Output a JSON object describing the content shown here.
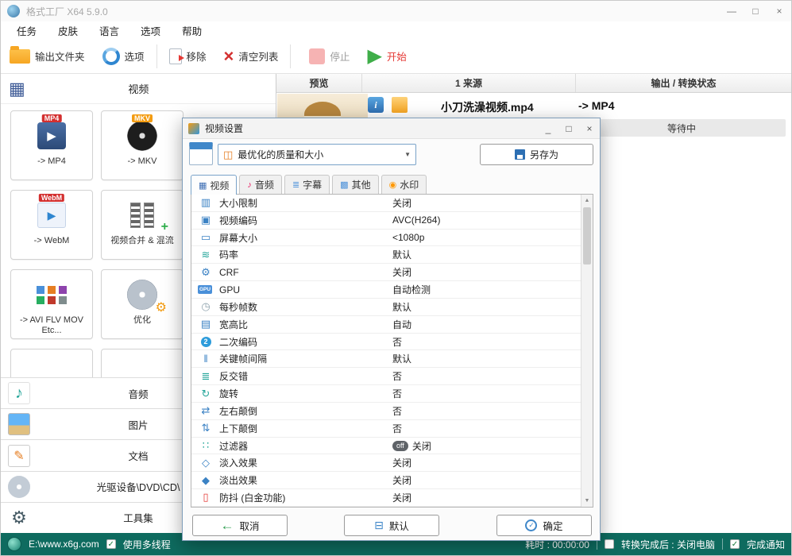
{
  "window": {
    "title": "格式工厂 X64 5.9.0",
    "menu": [
      "任务",
      "皮肤",
      "语言",
      "选项",
      "帮助"
    ]
  },
  "toolbar": {
    "output_folder": "输出文件夹",
    "options": "选项",
    "remove": "移除",
    "clear_list": "清空列表",
    "stop": "停止",
    "start": "开始"
  },
  "sidebar": {
    "header": "视频",
    "tiles": [
      {
        "badge": "MP4",
        "caption": "-> MP4"
      },
      {
        "badge": "MKV",
        "caption": "-> MKV"
      },
      {
        "badge": "WebM",
        "caption": "-> WebM"
      },
      {
        "caption": "视频合并 & 混流"
      },
      {
        "caption": "-> AVI FLV MOV Etc..."
      },
      {
        "caption": "优化"
      }
    ],
    "categories": [
      "音频",
      "图片",
      "文档",
      "光驱设备\\DVD\\CD\\",
      "工具集"
    ]
  },
  "table": {
    "columns": [
      "预览",
      "1 来源",
      "输出 / 转换状态"
    ],
    "row": {
      "source": "小刀洗澡视频.mp4",
      "arrow": "->",
      "output": "MP4",
      "status": "等待中"
    }
  },
  "dialog": {
    "title": "视频设置",
    "profile": "最优化的质量和大小",
    "save_as": "另存为",
    "tabs": [
      {
        "label": "视频",
        "icon": "▦"
      },
      {
        "label": "音频",
        "icon": "♪"
      },
      {
        "label": "字幕",
        "icon": "≣"
      },
      {
        "label": "其他",
        "icon": "▩"
      },
      {
        "label": "水印",
        "icon": "◉"
      }
    ],
    "settings": [
      {
        "label": "大小限制",
        "value": "关闭",
        "icon": "▥"
      },
      {
        "label": "视频编码",
        "value": "AVC(H264)",
        "icon": "▣"
      },
      {
        "label": "屏幕大小",
        "value": "<1080p",
        "icon": "▭"
      },
      {
        "label": "码率",
        "value": "默认",
        "icon": "≋"
      },
      {
        "label": "CRF",
        "value": "关闭",
        "icon": "⚙"
      },
      {
        "label": "GPU",
        "value": "自动检测",
        "icon": "GPU"
      },
      {
        "label": "每秒帧数",
        "value": "默认",
        "icon": "◷"
      },
      {
        "label": "宽高比",
        "value": "自动",
        "icon": "▤"
      },
      {
        "label": "二次编码",
        "value": "否",
        "icon": "2"
      },
      {
        "label": "关键帧间隔",
        "value": "默认",
        "icon": "‖"
      },
      {
        "label": "反交错",
        "value": "否",
        "icon": "≣"
      },
      {
        "label": "旋转",
        "value": "否",
        "icon": "↻"
      },
      {
        "label": "左右颠倒",
        "value": "否",
        "icon": "⇄"
      },
      {
        "label": "上下颠倒",
        "value": "否",
        "icon": "⇅"
      },
      {
        "label": "过滤器",
        "value": "关闭",
        "icon": "∷"
      },
      {
        "label": "淡入效果",
        "value": "关闭",
        "icon": "◇"
      },
      {
        "label": "淡出效果",
        "value": "关闭",
        "icon": "◆"
      },
      {
        "label": "防抖 (白金功能)",
        "value": "关闭",
        "icon": "▯"
      }
    ],
    "filter_off": "off",
    "buttons": {
      "cancel": "取消",
      "default": "默认",
      "ok": "确定"
    }
  },
  "statusbar": {
    "path": "E:\\www.x6g.com",
    "multithread": "使用多线程",
    "multithread_checked": true,
    "elapsed": "耗时 : 00:00:00",
    "after_done": "转换完成后 : 关闭电脑",
    "after_done_checked": false,
    "notify": "完成通知",
    "notify_checked": true
  },
  "icons": {
    "minimize": "—",
    "maximize": "□",
    "close": "×",
    "dialog_minimize": "_",
    "dialog_maximize": "□",
    "dialog_close": "×",
    "caret_down": "▼",
    "check": "✓",
    "scroll_up": "▲",
    "scroll_down": "▼",
    "play": "▶",
    "clear_x": "×",
    "info": "i",
    "merge_plus": "+",
    "gear": "⚙",
    "note": "♪",
    "pencil": "✎",
    "film": "▦",
    "cancel_arrow": "←",
    "default_glyph": "⊟",
    "profile_grid": "◫",
    "ok_check": "✓"
  },
  "colors": {
    "statusbar_bg": "#0e6b5f",
    "accent_blue": "#3f87c9",
    "start_green": "#3fae49",
    "start_text_red": "#e53935",
    "waiting_bg": "#e9e9e9"
  }
}
